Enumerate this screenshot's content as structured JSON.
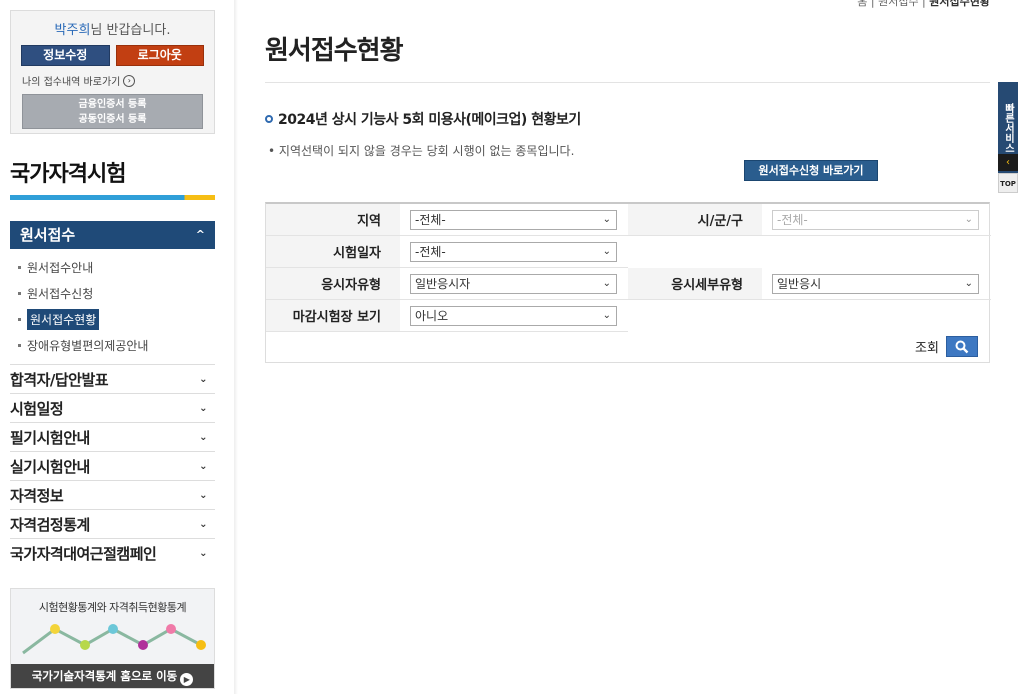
{
  "breadcrumb": {
    "home": "홈",
    "parent": "원서접수",
    "current": "원서접수현황"
  },
  "login": {
    "user_name": "박주희",
    "greeting_suffix": "님 반갑습니다.",
    "info_btn": "정보수정",
    "logout_btn": "로그아웃",
    "my_link": "나의 접수내역 바로가기",
    "cert_line1": "금융인증서 등록",
    "cert_line2": "공동인증서 등록"
  },
  "sidebar": {
    "section_title": "국가자격시험",
    "active_menu": "원서접수",
    "sub_items": [
      "원서접수안내",
      "원서접수신청",
      "원서접수현황",
      "장애유형별편의제공안내"
    ],
    "main_items": [
      "합격자/답안발표",
      "시험일정",
      "필기시험안내",
      "실기시험안내",
      "자격정보",
      "자격검정통계",
      "국가자격대여근절캠페인"
    ],
    "stats_title": "시험현황통계와 자격취득현황통계",
    "stats_link": "국가기술자격통계 홈으로 이동"
  },
  "main": {
    "page_title": "원서접수현황",
    "sub_heading": "2024년 상시 기능사 5회 미용사(메이크업) 현황보기",
    "notice": "지역선택이 되지 않을 경우는 당회 시행이 없는 종목입니다.",
    "quick_apply_btn": "원서접수신청 바로가기",
    "form": {
      "region_label": "지역",
      "region_value": "-전체-",
      "city_label": "시/군/구",
      "city_value": "-전체-",
      "date_label": "시험일자",
      "date_value": "-전체-",
      "applicant_type_label": "응시자유형",
      "applicant_type_value": "일반응시자",
      "detail_type_label": "응시세부유형",
      "detail_type_value": "일반응시",
      "closed_label": "마감시험장 보기",
      "closed_value": "아니오"
    },
    "search_label": "조회"
  },
  "quick_service": {
    "label": "빠른서비스",
    "top_label": "TOP"
  },
  "colors": {
    "primary": "#1f4a78",
    "logout": "#c23f12",
    "accent_blue": "#2f9fd8",
    "accent_yellow": "#f6be14"
  }
}
